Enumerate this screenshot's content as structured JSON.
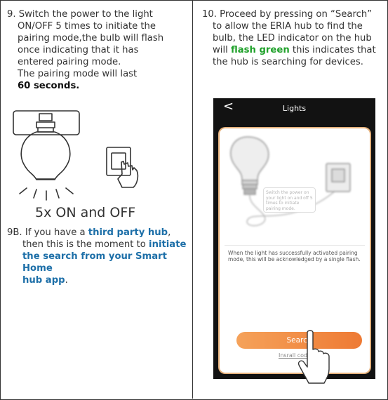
{
  "step9": {
    "line1": "9. Switch the power to the light",
    "line2": "ON/OFF 5 times to initiate the",
    "line3": "pairing mode,the bulb will flash",
    "line4": "once indicating that it has",
    "line5": "entered pairing  mode.",
    "line6": "The pairing mode will last",
    "bold": "60 seconds."
  },
  "illustration": {
    "caption": "5x ON and OFF"
  },
  "step9b": {
    "prefix": "9B. If you have a ",
    "highlight1": "third party hub",
    "mid1": ",",
    "mid2": "then this is the moment to ",
    "highlight2a": "initiate",
    "highlight2b": "the search from your Smart Home",
    "highlight2c": "hub app",
    "end": "."
  },
  "step10": {
    "line1": "10. Proceed by pressing on “Search”",
    "line2": "to allow the ERIA hub to find the",
    "line3": "bulb, the LED indicator on the hub",
    "line4_prefix": "will ",
    "line4_green": "flash green",
    "line4_suffix": " this indicates that",
    "line5": "the hub is searching for devices."
  },
  "phone": {
    "back": "<",
    "title": "Lights",
    "bubble": "Switch the power on your light on and off 5 times to initiate pairing mode.",
    "description": "When the light has successfully activated pairing mode, this will be acknowledged by a single flash.",
    "search_button": "Search",
    "install_link": "Insrall code"
  }
}
